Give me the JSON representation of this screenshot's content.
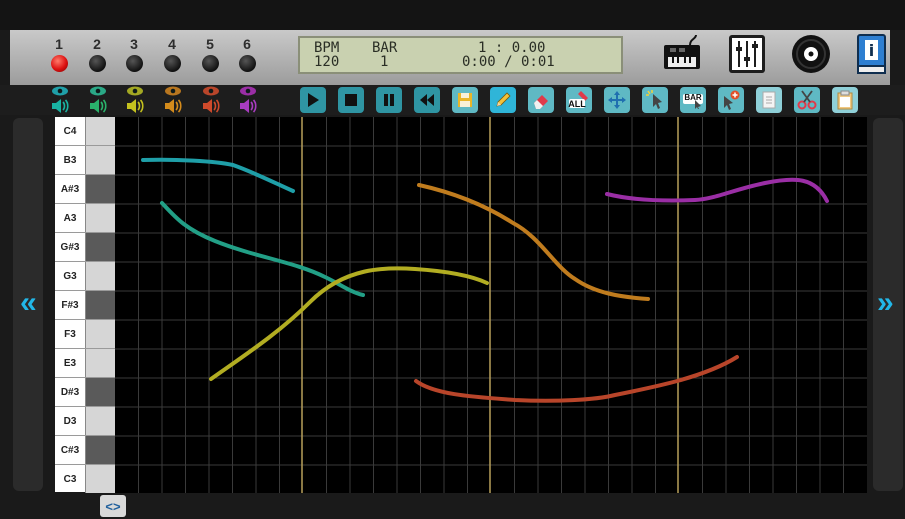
{
  "channels": [
    {
      "num": "1",
      "led": "on",
      "eye_color": "#1f9fa8",
      "speaker_color": "#19b3a3"
    },
    {
      "num": "2",
      "led": "off",
      "eye_color": "#2aa886",
      "speaker_color": "#2ab36c"
    },
    {
      "num": "3",
      "led": "off",
      "eye_color": "#a3a823",
      "speaker_color": "#c4c11e"
    },
    {
      "num": "4",
      "led": "off",
      "eye_color": "#b8761f",
      "speaker_color": "#d48b1b"
    },
    {
      "num": "5",
      "led": "off",
      "eye_color": "#b8452a",
      "speaker_color": "#cf4a2b"
    },
    {
      "num": "6",
      "led": "off",
      "eye_color": "#9a2ea5",
      "speaker_color": "#a83cc0"
    }
  ],
  "lcd": {
    "bpm_label": "BPM",
    "bpm_value": "120",
    "bar_label": "BAR",
    "bar_value": "1",
    "position": "1 : 0.00",
    "time": "0:00 / 0:01"
  },
  "toolbar_icons": [
    "play-icon",
    "stop-icon",
    "pause-icon",
    "rewind-icon",
    "save-icon",
    "pencil-icon",
    "eraser-icon",
    "select-all-icon",
    "move-icon",
    "select-icon",
    "bar-icon",
    "insert-icon",
    "paste-icon",
    "cut-icon",
    "clipboard-icon"
  ],
  "toolbar_text": {
    "select_all": "ALL",
    "bar": "BAR"
  },
  "piano_keys": [
    "C4",
    "B3",
    "A#3",
    "A3",
    "G#3",
    "G3",
    "F#3",
    "F3",
    "E3",
    "D#3",
    "D3",
    "C#3",
    "C3"
  ],
  "nav": {
    "left": "«",
    "right": "»"
  },
  "scroll_handle": "<>",
  "colors": {
    "accent": "#22b7e8",
    "lcd_bg": "#c9d1b0",
    "bar_line": "#b8a05a"
  }
}
